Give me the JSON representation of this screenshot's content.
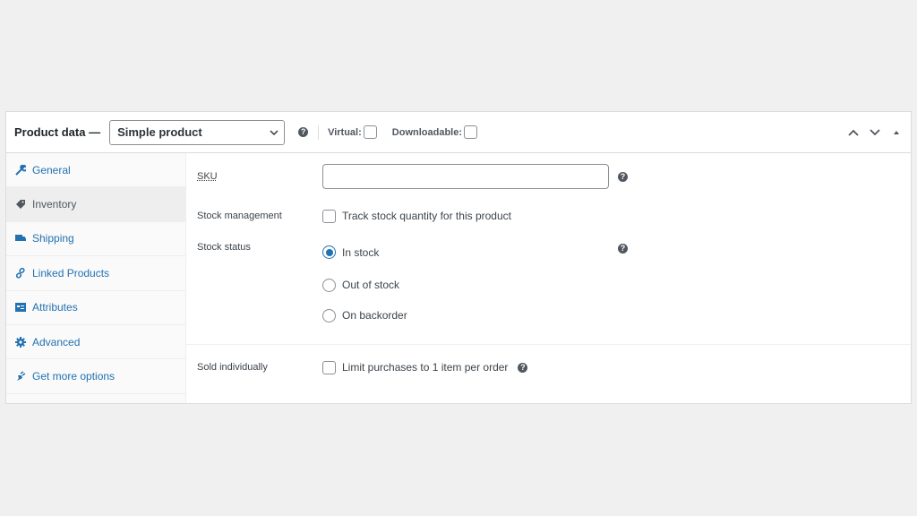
{
  "header": {
    "title": "Product data —",
    "product_type": "Simple product",
    "help_glyph": "?",
    "virtual_label": "Virtual:",
    "virtual_checked": false,
    "downloadable_label": "Downloadable:",
    "downloadable_checked": false,
    "actions": [
      "move-up-icon",
      "move-down-icon",
      "toggle-panel-icon"
    ]
  },
  "tabs": [
    {
      "label": "General",
      "icon": "wrench-icon",
      "active": false
    },
    {
      "label": "Inventory",
      "icon": "tag-icon",
      "active": true
    },
    {
      "label": "Shipping",
      "icon": "truck-icon",
      "active": false
    },
    {
      "label": "Linked Products",
      "icon": "link-icon",
      "active": false
    },
    {
      "label": "Attributes",
      "icon": "list-card-icon",
      "active": false
    },
    {
      "label": "Advanced",
      "icon": "gear-icon",
      "active": false
    },
    {
      "label": "Get more options",
      "icon": "plugin-icon",
      "active": false
    }
  ],
  "inventory": {
    "sku_label": "SKU",
    "sku_value": "",
    "stock_management_label": "Stock management",
    "stock_management_text": "Track stock quantity for this product",
    "stock_management_checked": false,
    "stock_status_label": "Stock status",
    "stock_status_options": [
      {
        "label": "In stock",
        "selected": true
      },
      {
        "label": "Out of stock",
        "selected": false
      },
      {
        "label": "On backorder",
        "selected": false
      }
    ],
    "sold_individually_label": "Sold individually",
    "sold_individually_text": "Limit purchases to 1 item per order",
    "sold_individually_checked": false
  },
  "colors": {
    "accent": "#2271b1",
    "background": "#f0f0f1",
    "panel": "#ffffff",
    "tab_active_bg": "#eeeeee"
  }
}
